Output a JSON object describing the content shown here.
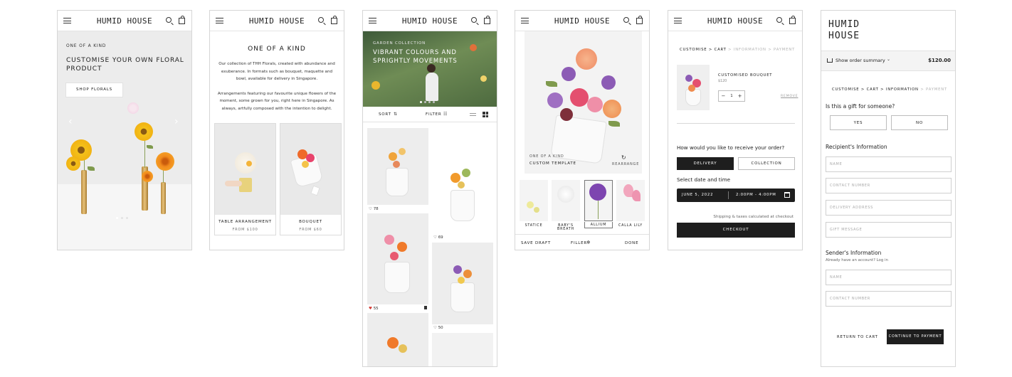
{
  "brand": "HUMID HOUSE",
  "brand_stacked": [
    "HUMID",
    "HOUSE"
  ],
  "screen1": {
    "eyebrow": "ONE OF A KIND",
    "headline_line1": "CUSTOMISE YOUR OWN FLORAL",
    "headline_line2": "PRODUCT",
    "cta": "SHOP FLORALS",
    "prev": "‹",
    "next": "›"
  },
  "screen2": {
    "title": "ONE OF A KIND",
    "para1_line1": "Our collection of THH Florals, created with abundance and",
    "para1_line2": "exuberance. In formats such as bouquet, maquette and",
    "para1_line3": "bowl, available for delivery in Singapore.",
    "para2_line1": "Arrangements featuring our favourite unique flowers of the",
    "para2_line2": "moment, some grown for you, right here in Singapore. As",
    "para2_line3": "always, artfully composed with the intention to delight.",
    "cards": [
      {
        "name": "TABLE ARRANGEMENT",
        "price": "FROM $100"
      },
      {
        "name": "BOUQUET",
        "price": "FROM $60"
      }
    ]
  },
  "screen3": {
    "eyebrow": "GARDEN COLLECTION",
    "headline_line1": "VIBRANT COLOURS AND",
    "headline_line2": "SPRIGHTLY MOVEMENTS",
    "sort": "SORT",
    "filter": "FILTER",
    "likes": [
      "78",
      "69",
      "55",
      "50"
    ]
  },
  "screen4": {
    "eyebrow": "ONE OF A KIND",
    "template": "CUSTOM TEMPLATE",
    "rearrange": "REARRANGE",
    "flowers": [
      "STATICE",
      "BABY'S BREATH",
      "ALLIUM",
      "CALLA LILY"
    ],
    "save": "SAVE DRAFT",
    "filler": "FILLER",
    "done": "DONE"
  },
  "screen5": {
    "crumb_customise": "CUSTOMISE",
    "crumb_cart": "CART",
    "crumb_info": "INFORMATION",
    "crumb_payment": "PAYMENT",
    "sep": ">",
    "item_name": "CUSTOMISED BOUQUET",
    "item_price": "$120",
    "qty": "1",
    "minus": "−",
    "plus": "+",
    "remove": "REMOVE",
    "receive_q": "How would you like to receive your order?",
    "delivery": "DELIVERY",
    "collection": "COLLECTION",
    "date_label": "Select date and time",
    "date": "JUNE 5, 2022",
    "time": "2:00PM - 4:00PM",
    "shipping": "Shipping & taxes calculated at checkout",
    "checkout": "CHECKOUT"
  },
  "screen6": {
    "summary": "Show order summary",
    "total": "$120.00",
    "gift_q": "Is this a gift for someone?",
    "yes": "YES",
    "no": "NO",
    "recipient": "Recipient's Information",
    "recipient_fields": [
      "NAME",
      "CONTACT NUMBER",
      "DELIVERY ADDRESS",
      "GIFT MESSAGE"
    ],
    "sender": "Sender's Information",
    "account": "Already have an account? Log in",
    "sender_fields": [
      "NAME",
      "CONTACT NUMBER"
    ],
    "return": "RETURN TO CART",
    "continue": "CONTINUE TO PAYMENT"
  },
  "colors": {
    "dark": "#1e1e1e",
    "yellow": "#f2b705",
    "orange": "#ef7d2b",
    "pink": "#ee8fa8",
    "purple": "#8c5bb5"
  }
}
